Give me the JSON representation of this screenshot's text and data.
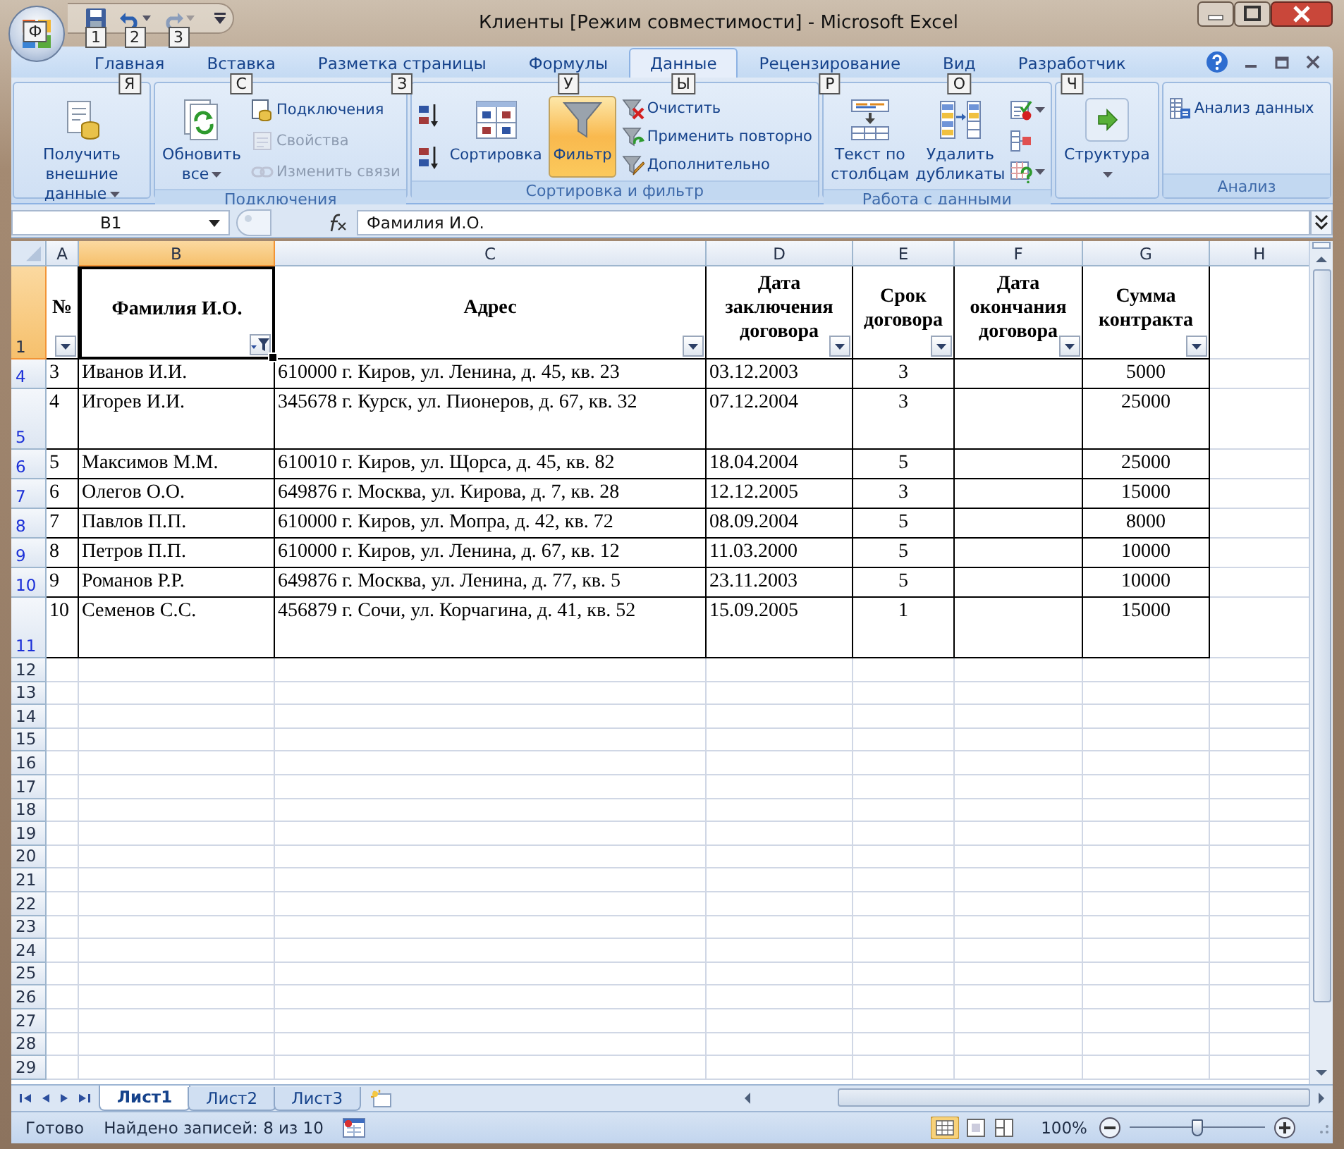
{
  "window": {
    "title": "Клиенты  [Режим совместимости] - Microsoft Excel"
  },
  "office_button": {
    "keytip": "Ф"
  },
  "quick_access": [
    {
      "keytip": "1",
      "disabled": false
    },
    {
      "keytip": "2",
      "disabled": false
    },
    {
      "keytip": "3",
      "disabled": true
    }
  ],
  "tabs": [
    {
      "label": "Главная",
      "keytip": "Я",
      "selected": false
    },
    {
      "label": "Вставка",
      "keytip": "С",
      "selected": false
    },
    {
      "label": "Разметка страницы",
      "keytip": "З",
      "selected": false
    },
    {
      "label": "Формулы",
      "keytip": "У",
      "selected": false
    },
    {
      "label": "Данные",
      "keytip": "Ы",
      "selected": true
    },
    {
      "label": "Рецензирование",
      "keytip": "Р",
      "selected": false
    },
    {
      "label": "Вид",
      "keytip": "О",
      "selected": false
    },
    {
      "label": "Разработчик",
      "keytip": "Ч",
      "selected": false
    }
  ],
  "ribbon_groups": [
    {
      "items": [
        {
          "kind": "large",
          "label": "Получить внешние данные",
          "dropdown": true,
          "disabled": false,
          "pressed": false
        }
      ]
    },
    {
      "label": "Подключения",
      "items": [
        {
          "kind": "large",
          "label": "Обновить все",
          "dropdown": true,
          "disabled": false,
          "pressed": false
        },
        {
          "kind": "small",
          "label": "Подключения",
          "disabled": false,
          "pressed": false
        },
        {
          "kind": "small",
          "label": "Свойства",
          "disabled": true,
          "pressed": false
        },
        {
          "kind": "small",
          "label": "Изменить связи",
          "disabled": true,
          "pressed": false
        }
      ]
    },
    {
      "label": "Сортировка и фильтр",
      "items": [
        {
          "kind": "icon",
          "disabled": false,
          "pressed": false
        },
        {
          "kind": "icon",
          "disabled": false,
          "pressed": false
        },
        {
          "kind": "large",
          "label": "Сортировка",
          "disabled": false,
          "pressed": false
        },
        {
          "kind": "large",
          "label": "Фильтр",
          "disabled": false,
          "pressed": true
        },
        {
          "kind": "small",
          "label": "Очистить",
          "disabled": false,
          "pressed": false
        },
        {
          "kind": "small",
          "label": "Применить повторно",
          "disabled": false,
          "pressed": false
        },
        {
          "kind": "small",
          "label": "Дополнительно",
          "disabled": false,
          "pressed": false
        }
      ]
    },
    {
      "label": "Работа с данными",
      "items": [
        {
          "kind": "large",
          "label": "Текст по столбцам",
          "disabled": false,
          "pressed": false
        },
        {
          "kind": "large",
          "label": "Удалить дубликаты",
          "disabled": false,
          "pressed": false
        },
        {
          "kind": "icon",
          "dropdown": true,
          "disabled": false,
          "pressed": false
        },
        {
          "kind": "icon",
          "disabled": false,
          "pressed": false
        },
        {
          "kind": "icon",
          "dropdown": true,
          "disabled": false,
          "pressed": false
        }
      ]
    },
    {
      "items": [
        {
          "kind": "large",
          "label": "Структура",
          "dropdown": true,
          "disabled": false,
          "pressed": false
        }
      ]
    },
    {
      "label": "Анализ",
      "items": [
        {
          "kind": "small",
          "label": "Анализ данных",
          "disabled": false,
          "pressed": false
        }
      ]
    }
  ],
  "formula_bar": {
    "name_box": "B1",
    "formula": "Фамилия И.О."
  },
  "columns": [
    {
      "letter": "A",
      "selected": false
    },
    {
      "letter": "B",
      "selected": true
    },
    {
      "letter": "C",
      "selected": false
    },
    {
      "letter": "D",
      "selected": false
    },
    {
      "letter": "E",
      "selected": false
    },
    {
      "letter": "F",
      "selected": false
    },
    {
      "letter": "G",
      "selected": false
    },
    {
      "letter": "H",
      "selected": false
    }
  ],
  "header_row": {
    "number": "1",
    "selected": true,
    "cells": [
      {
        "text": "№",
        "filtered": false
      },
      {
        "text": "Фамилия И.О.",
        "filtered": true
      },
      {
        "text": "Адрес",
        "filtered": false
      },
      {
        "text": "Дата заключения договора",
        "filtered": false
      },
      {
        "text": "Срок договора",
        "filtered": false
      },
      {
        "text": "Дата окончания договора",
        "filtered": false
      },
      {
        "text": "Сумма контракта",
        "filtered": false
      }
    ]
  },
  "rows": [
    {
      "number": "4",
      "kind": "single",
      "filtered": true,
      "cells": {
        "A": "3",
        "B": "Иванов И.И.",
        "C": "610000 г. Киров, ул. Ленина, д. 45, кв. 23",
        "D": "03.12.2003",
        "E": "3",
        "G": "5000"
      }
    },
    {
      "number": "5",
      "kind": "double",
      "filtered": true,
      "cells": {
        "A": "4",
        "B": "Игорев И.И.",
        "C": "345678 г. Курск, ул. Пионеров, д. 67, кв. 32",
        "D": "07.12.2004",
        "E": "3",
        "G": "25000"
      }
    },
    {
      "number": "6",
      "kind": "single",
      "filtered": true,
      "cells": {
        "A": "5",
        "B": "Максимов М.М.",
        "C": "610010 г. Киров, ул. Щорса, д. 45, кв. 82",
        "D": "18.04.2004",
        "E": "5",
        "G": "25000"
      }
    },
    {
      "number": "7",
      "kind": "single",
      "filtered": true,
      "cells": {
        "A": "6",
        "B": "Олегов О.О.",
        "C": "649876 г. Москва, ул. Кирова, д. 7, кв. 28",
        "D": "12.12.2005",
        "E": "3",
        "G": "15000"
      }
    },
    {
      "number": "8",
      "kind": "single",
      "filtered": true,
      "cells": {
        "A": "7",
        "B": "Павлов П.П.",
        "C": "610000 г. Киров, ул. Мопра, д. 42, кв. 72",
        "D": "08.09.2004",
        "E": "5",
        "G": "8000"
      }
    },
    {
      "number": "9",
      "kind": "single",
      "filtered": true,
      "cells": {
        "A": "8",
        "B": "Петров П.П.",
        "C": "610000 г. Киров, ул. Ленина, д. 67, кв. 12",
        "D": "11.03.2000",
        "E": "5",
        "G": "10000"
      }
    },
    {
      "number": "10",
      "kind": "single",
      "filtered": true,
      "cells": {
        "A": "9",
        "B": "Романов Р.Р.",
        "C": "649876 г. Москва, ул. Ленина, д. 77, кв. 5",
        "D": "23.11.2003",
        "E": "5",
        "G": "10000"
      }
    },
    {
      "number": "11",
      "kind": "double",
      "filtered": true,
      "cells": {
        "A": "10",
        "B": "Семенов С.С.",
        "C": "456879 г. Сочи, ул. Корчагина, д. 41, кв. 52",
        "D": "15.09.2005",
        "E": "1",
        "G": "15000"
      }
    }
  ],
  "empty_rows": [
    "12",
    "13",
    "14",
    "15",
    "16",
    "17",
    "18",
    "19",
    "20",
    "21",
    "22",
    "23",
    "24",
    "25",
    "26",
    "27",
    "28",
    "29"
  ],
  "sheet_tabs": [
    {
      "label": "Лист1",
      "selected": true
    },
    {
      "label": "Лист2",
      "selected": false
    },
    {
      "label": "Лист3",
      "selected": false
    }
  ],
  "status_bar": {
    "state": "Готово",
    "records": "Найдено записей: 8 из 10",
    "zoom": "100%",
    "zoom_slider": {
      "level": 0.5
    }
  }
}
